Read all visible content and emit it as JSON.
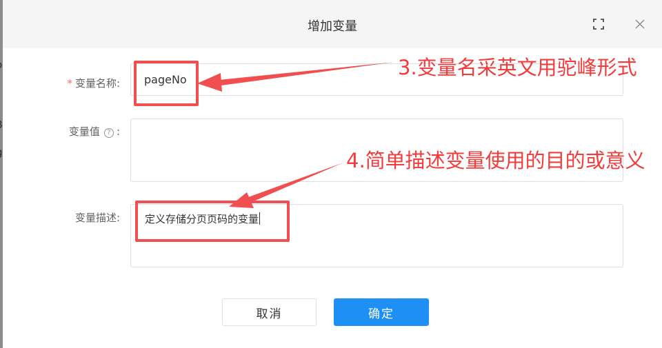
{
  "dialog": {
    "title": "增加变量",
    "fullscreen_icon": "fullscreen-icon",
    "close_icon": "close-icon"
  },
  "form": {
    "name_required_mark": "*",
    "name_label": "变量名称:",
    "name_value": "pageNo",
    "value_label": "变量值",
    "value_help_icon": "question-circle-icon",
    "value_label_colon": ":",
    "value_value": "",
    "desc_label": "变量描述:",
    "desc_value": "定义存储分页页码的变量"
  },
  "buttons": {
    "cancel_label": "取消",
    "ok_label": "确定"
  },
  "annotations": {
    "note_3": "3.变量名采英文用驼峰形式",
    "note_4": "4.简单描述变量使用的目的或意义",
    "color": "#f23c3c"
  },
  "colors": {
    "primary": "#1e90f5",
    "annotation_red": "#f14f4f",
    "required_red": "#f56c6c"
  }
}
